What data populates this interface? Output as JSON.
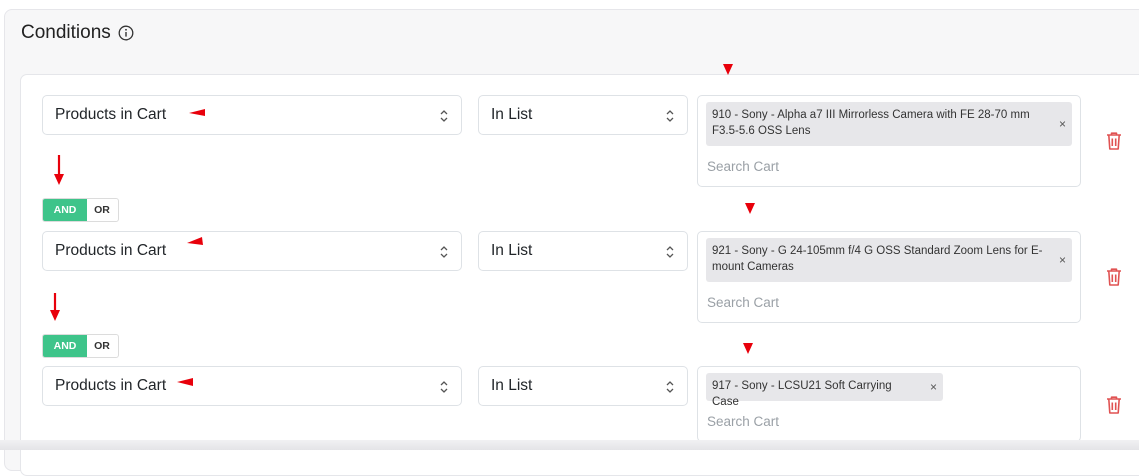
{
  "section": {
    "title": "Conditions",
    "info_icon": "info-circle-icon"
  },
  "conditions": [
    {
      "field": "Products in Cart",
      "operator": "In List",
      "tag": "910 - Sony - Alpha a7 III Mirrorless Camera with FE 28-70 mm F3.5-5.6 OSS Lens",
      "tag_remove": "×",
      "placeholder": "Search Cart"
    },
    {
      "field": "Products in Cart",
      "operator": "In List",
      "tag": "921 - Sony - G 24-105mm f/4 G OSS Standard Zoom Lens for E-mount Cameras",
      "tag_remove": "×",
      "placeholder": "Search Cart"
    },
    {
      "field": "Products in Cart",
      "operator": "In List",
      "tag": "917 - Sony - LCSU21 Soft Carrying Case",
      "tag_remove": "×",
      "placeholder": "Search Cart"
    }
  ],
  "logic_toggles": [
    {
      "and_label": "AND",
      "or_label": "OR",
      "selected": "AND"
    },
    {
      "and_label": "AND",
      "or_label": "OR",
      "selected": "AND"
    }
  ],
  "colors": {
    "accent_green": "#3ec48a",
    "delete_red": "#e05252",
    "annotation_red": "#e8000b"
  }
}
